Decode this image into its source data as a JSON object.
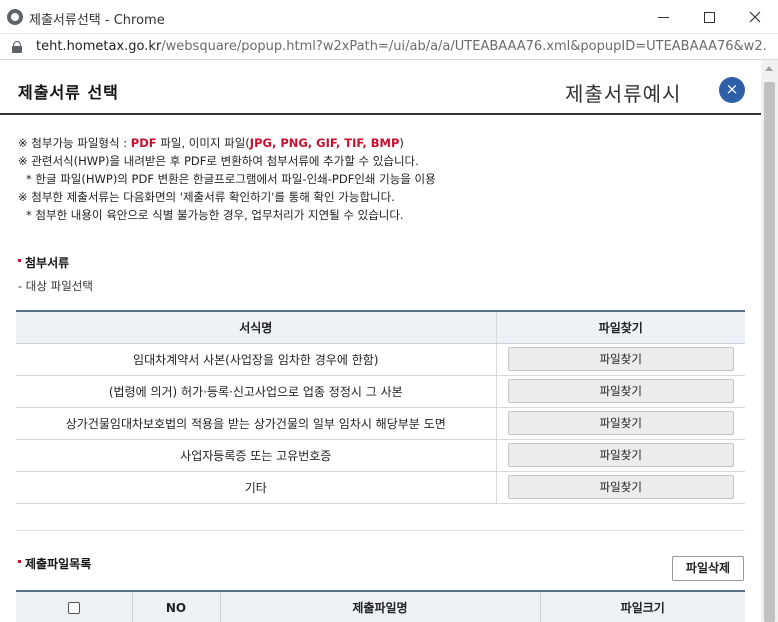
{
  "window": {
    "title": "제출서류선택 - Chrome",
    "url_host": "teht.hometax.go.kr",
    "url_rest": "/websquare/popup.html?w2xPath=/ui/ab/a/a/UTEABAAA76.xml&popupID=UTEABAAA76&w2..."
  },
  "header": {
    "title": "제출서류 선택",
    "example_link": "제출서류예시",
    "close_symbol": "×"
  },
  "notices": {
    "line1_prefix": "※ 첨부가능 파일형식 : ",
    "line1_pdf": "PDF",
    "line1_mid": " 파일, 이미지 파일(",
    "line1_types": "JPG, PNG, GIF, TIF, BMP",
    "line1_suffix": ")",
    "line2": "※ 관련서식(HWP)을 내려받은 후 PDF로 변환하여 첨부서류에 추가할 수 있습니다.",
    "line3": "* 한글 파일(HWP)의 PDF 변환은 한글프로그램에서 파일-인쇄-PDF인쇄 기능을 이용",
    "line4": "※ 첨부한 제출서류는 다음화면의 '제출서류 확인하기'를 통해 확인 가능합니다.",
    "line5": "* 첨부한 내용이 육안으로 식별 불가능한 경우, 업무처리가 지연될 수 있습니다."
  },
  "attach_section": {
    "title": "첨부서류",
    "sub_label": "- 대상 파일선택",
    "columns": [
      "서식명",
      "파일찾기"
    ],
    "rows": [
      {
        "name": "임대차계약서 사본(사업장을 임차한 경우에 한함)",
        "button": "파일찾기"
      },
      {
        "name": "(법령에 의거) 허가·등록·신고사업으로 업종 정정시 그 사본",
        "button": "파일찾기"
      },
      {
        "name": "상가건물임대차보호법의 적용을 받는 상가건물의 일부 임차시 해당부분 도면",
        "button": "파일찾기"
      },
      {
        "name": "사업자등록증 또는 고유번호증",
        "button": "파일찾기"
      },
      {
        "name": "기타",
        "button": "파일찾기"
      }
    ]
  },
  "submit_section": {
    "title": "제출파일목록",
    "delete_button": "파일삭제",
    "columns": [
      "NO",
      "제출파일명",
      "파일크기"
    ]
  }
}
